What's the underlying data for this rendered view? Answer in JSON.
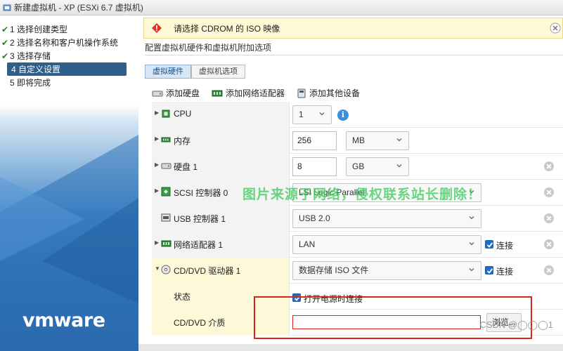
{
  "window": {
    "title": "新建虚拟机 - XP (ESXi 6.7 虚拟机)"
  },
  "steps": [
    {
      "label": "1 选择创建类型",
      "done": true
    },
    {
      "label": "2 选择名称和客户机操作系统",
      "done": true
    },
    {
      "label": "3 选择存储",
      "done": true
    },
    {
      "label": "4 自定义设置",
      "active": true
    },
    {
      "label": "5 即将完成"
    }
  ],
  "brand": {
    "logo": "vmware"
  },
  "warning": {
    "text": "请选择 CDROM 的 ISO 映像",
    "icon": "warning-icon"
  },
  "page": {
    "subtitle": "配置虚拟机硬件和虚拟机附加选项"
  },
  "tabs": [
    {
      "label": "虚拟硬件",
      "active": true
    },
    {
      "label": "虚拟机选项"
    }
  ],
  "toolbar": {
    "add_disk": "添加硬盘",
    "add_network": "添加网络适配器",
    "add_other": "添加其他设备"
  },
  "hardware": {
    "cpu": {
      "label": "CPU",
      "value": "1"
    },
    "memory": {
      "label": "内存",
      "value": "256",
      "unit": "MB"
    },
    "disk": {
      "label": "硬盘 1",
      "value": "8",
      "unit": "GB"
    },
    "scsi": {
      "label": "SCSI 控制器 0",
      "value": "LSI Logic Parallel"
    },
    "usb": {
      "label": "USB 控制器 1",
      "value": "USB 2.0"
    },
    "network": {
      "label": "网络适配器 1",
      "value": "LAN",
      "connect_label": "连接"
    },
    "cdrom": {
      "label": "CD/DVD 驱动器 1",
      "value": "数据存储 ISO 文件",
      "connect_label": "连接",
      "status_label": "状态",
      "status_option": "打开电源时连接",
      "media_label": "CD/DVD 介质",
      "media_value": "",
      "browse_label": "浏览..."
    }
  },
  "overlay": {
    "watermark": "图片来源于网络，侵权联系站长删除！",
    "credit": "CSDN @◯◯◯1"
  }
}
